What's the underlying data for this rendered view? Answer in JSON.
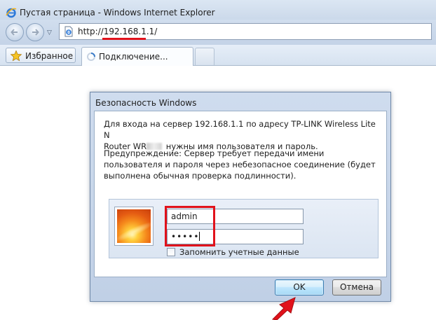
{
  "window": {
    "title": "Пустая страница - Windows Internet Explorer"
  },
  "address": {
    "url": "http://192.168.1.1/"
  },
  "favorites": {
    "label": "Избранное"
  },
  "tab": {
    "label": "Подключение..."
  },
  "dialog": {
    "title": "Безопасность Windows",
    "message_line1": "Для входа на сервер 192.168.1.1 по адресу TP-LINK Wireless Lite N",
    "message_line2_prefix": "Router WR",
    "message_line2_suffix": " нужны имя пользователя и пароль.",
    "warning": "Предупреждение: Сервер требует передачи имени пользователя и пароля через небезопасное соединение (будет выполнена обычная проверка подлинности).",
    "username_value": "admin",
    "password_value": "•••••",
    "remember_label": "Запомнить учетные данные",
    "remember_checked": false,
    "ok_label": "OK",
    "cancel_label": "Отмена"
  },
  "colors": {
    "highlight": "#e1121b",
    "chrome": "#cfdcec"
  },
  "icons": {
    "browser": "ie-icon",
    "back": "back-arrow-icon",
    "forward": "forward-arrow-icon",
    "page": "page-icon",
    "favorites": "star-icon",
    "loading": "loading-icon",
    "user": "user-picture-icon",
    "pointer": "red-arrow-icon"
  }
}
